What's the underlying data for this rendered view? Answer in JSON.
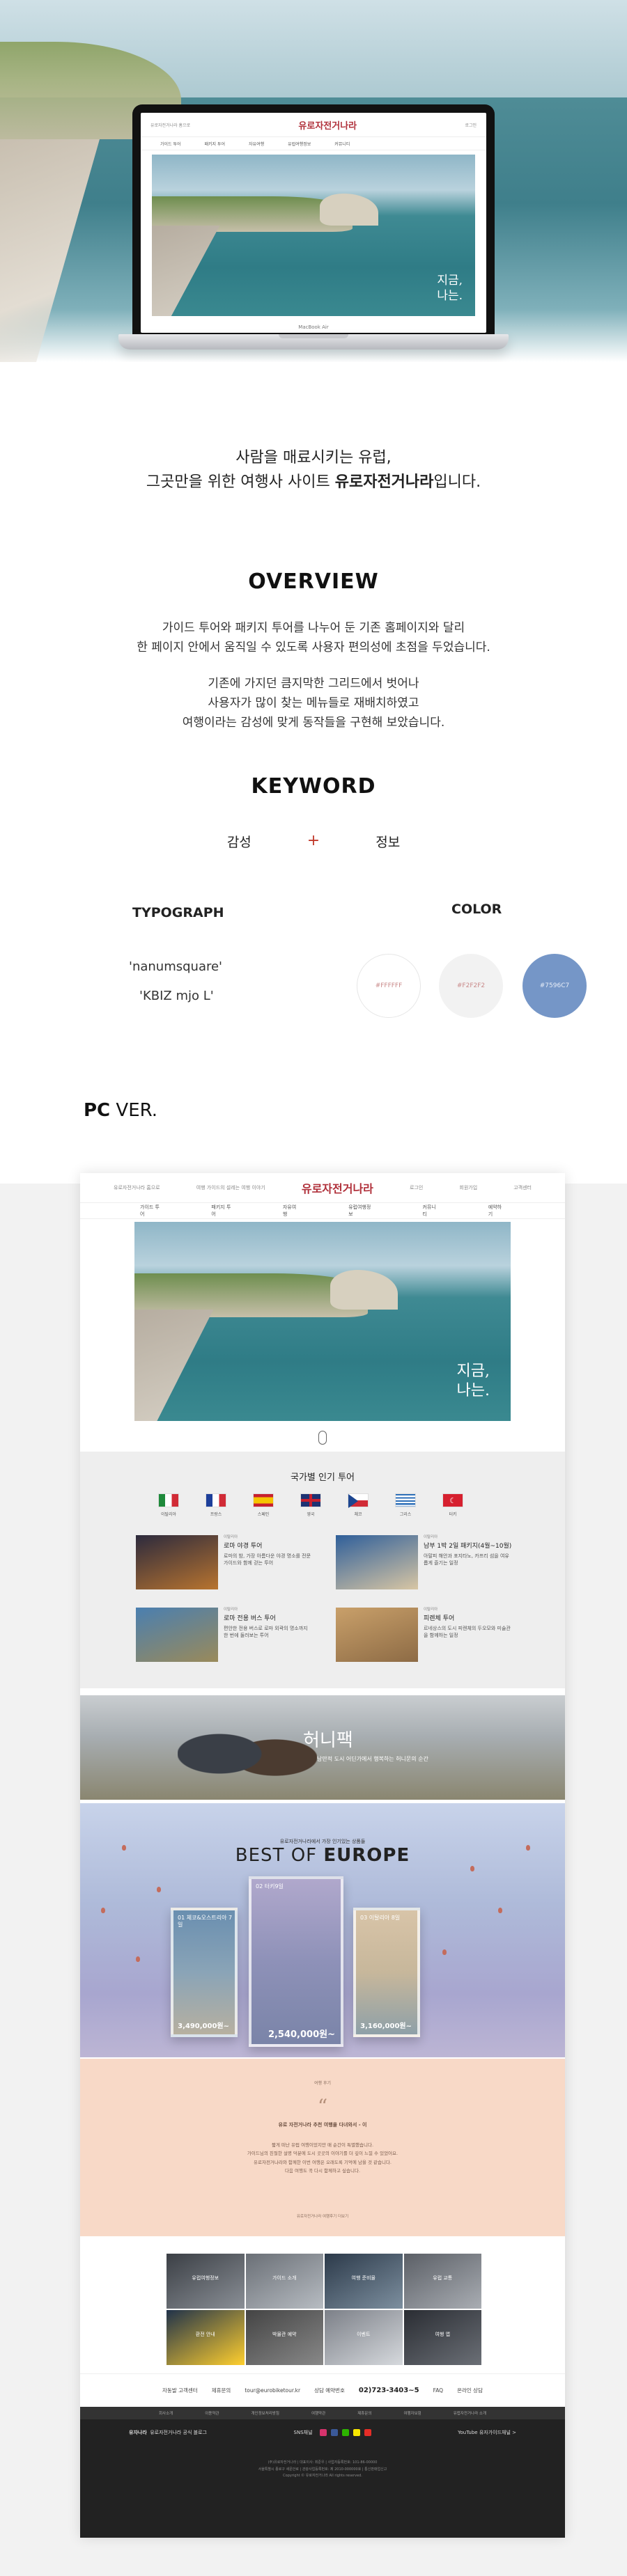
{
  "hero": {
    "laptop_label": "MacBook Air",
    "site_slogan": [
      "지금,",
      "나는."
    ]
  },
  "site": {
    "logo": "유로자전거나라",
    "top_left": [
      "유로자전거나라 홈으로",
      "여행 가이드의 설레는 여행 이야기"
    ],
    "top_right": [
      "로그인",
      "회원가입",
      "고객센터"
    ],
    "nav": [
      "가이드 투어",
      "패키지 투어",
      "자유여행",
      "유럽여행정보",
      "커뮤니티",
      "예약하기"
    ]
  },
  "intro": {
    "line1": "사람을 매료시키는 유럽,",
    "line2_prefix": "그곳만을 위한 여행사 사이트 ",
    "line2_brand": "유로자전거나라",
    "line2_suffix": "입니다."
  },
  "overview": {
    "title": "OVERVIEW",
    "p1": [
      "가이드 투어와 패키지 투어를 나누어 둔 기존 홈페이지와 달리",
      "한 페이지 안에서 움직일 수 있도록 사용자 편의성에 초점을 두었습니다."
    ],
    "p2": [
      "기존에 가지던 큼지막한 그리드에서 벗어나",
      "사용자가 많이 찾는 메뉴들로 재배치하였고",
      "여행이라는 감성에 맞게 동작들을 구현해 보았습니다."
    ]
  },
  "keyword": {
    "title": "KEYWORD",
    "left": "감성",
    "plus": "+",
    "right": "정보"
  },
  "typography": {
    "title": "TYPOGRAPH",
    "fonts": [
      "'nanumsquare'",
      "'KBIZ mjo L'"
    ]
  },
  "color": {
    "title": "COLOR",
    "swatches": [
      {
        "label": "#FFFFFF",
        "hex": "#FFFFFF"
      },
      {
        "label": "#F2F2F2",
        "hex": "#F2F2F2"
      },
      {
        "label": "#7596C7",
        "hex": "#7596C7"
      }
    ]
  },
  "pc_ver": {
    "bold": "PC",
    "rest": " VER."
  },
  "popular": {
    "title": "국가별 인기 투어",
    "flags": [
      {
        "name": "이탈리아",
        "colors": [
          "#1f8a3b",
          "#ffffff",
          "#d12b36"
        ],
        "dir": "v"
      },
      {
        "name": "프랑스",
        "colors": [
          "#1d3f9a",
          "#ffffff",
          "#d12b36"
        ],
        "dir": "v"
      },
      {
        "name": "스페인",
        "colors": [
          "#c8202f",
          "#f6c400",
          "#c8202f"
        ],
        "dir": "h"
      },
      {
        "name": "영국",
        "colors": [
          "#1d3273",
          "#ffffff",
          "#c8202f"
        ],
        "dir": "uk"
      },
      {
        "name": "체코",
        "colors": [
          "#ffffff",
          "#d12b36",
          "#1d4690"
        ],
        "dir": "cz"
      },
      {
        "name": "그리스",
        "colors": [
          "#2d6fb8",
          "#ffffff",
          "#2d6fb8"
        ],
        "dir": "gr"
      },
      {
        "name": "터키",
        "colors": [
          "#d6202f",
          "#ffffff",
          "#d6202f"
        ],
        "dir": "tr"
      }
    ],
    "tours": [
      {
        "tag": "이탈리아",
        "title": "로마 야경 투어",
        "desc": "로마의 밤, 가장 아름다운 야경 명소를 전문 가이드와 함께 걷는 투어",
        "thumb": [
          "#2c2a3d",
          "#b8742f"
        ]
      },
      {
        "tag": "이탈리아",
        "title": "남부 1박 2일 패키지(4월~10월)",
        "desc": "아말피 해안과 포지타노, 카프리 섬을 여유롭게 즐기는 일정",
        "thumb": [
          "#2f5f9a",
          "#d8c6a4"
        ]
      },
      {
        "tag": "이탈리아",
        "title": "로마 전용 버스 투어",
        "desc": "편안한 전용 버스로 로마 외곽의 명소까지 한 번에 둘러보는 투어",
        "thumb": [
          "#4a7fb0",
          "#9a8a5a"
        ]
      },
      {
        "tag": "이탈리아",
        "title": "피렌체 투어",
        "desc": "르네상스의 도시 피렌체의 두오모와 미술관을 함께하는 일정",
        "thumb": [
          "#c9a06a",
          "#8d6b45"
        ]
      }
    ]
  },
  "honeymoon": {
    "title": "허니팩",
    "sub": "낭만적 도시 어딘가에서 행복하는 허니문의 순간"
  },
  "best": {
    "sub": "유로자전거나라에서 가장 인기있는 상품들",
    "title_plain": "BEST OF ",
    "title_bold": "EUROPE",
    "cards": [
      {
        "label": "01 체코&오스트리아 7일",
        "price": "3,490,000원~"
      },
      {
        "label": "02 터키9일",
        "price": "2,540,000원~"
      },
      {
        "label": "03 이탈리아 8일",
        "price": "3,160,000원~"
      }
    ]
  },
  "review": {
    "tag": "여행 후기",
    "quote": "“",
    "head": "유로 자전거나라 추천 여행을 다녀와서 - 이",
    "body": [
      "짧게 떠난 유럽 여행이었지만 매 순간이 특별했습니다.",
      "가이드님의 친절한 설명 덕분에 도시 곳곳의 이야기를 더 깊이 느낄 수 있었어요.",
      "유로자전거나라와 함께한 이번 여행은 오래도록 기억에 남을 것 같습니다.",
      "다음 여행도 꼭 다시 함께하고 싶습니다."
    ],
    "foot": "유로자전거나라 여행후기 더보기"
  },
  "gallery": [
    "유럽여행정보",
    "가이드 소개",
    "여행 준비물",
    "유럽 교통",
    "환전 안내",
    "박물관 예약",
    "이벤트",
    "여행 앱"
  ],
  "contact": {
    "items": [
      "자동발 고객센터",
      "제휴문의",
      "tour@eurobiketour.kr",
      "상담 예약번호"
    ],
    "phone": "02)723-3403~5",
    "extra": [
      "FAQ",
      "온라인 상담"
    ]
  },
  "footer": {
    "menu": [
      "회사소개",
      "이용약관",
      "개인정보처리방침",
      "여행약관",
      "제휴문의",
      "여행자보험",
      "유럽자전거나라 소개"
    ],
    "left": "유자나라",
    "left_sub": "유로자전거나라 공식 블로그",
    "sns_label": "SNS채널",
    "right": "YouTube 유자가이드채널 >",
    "fine": [
      "(주)유로자전거나라 | 대표이사: 최준우 | 사업자등록번호: 101-86-00000",
      "서울특별시 종로구 새문안로 | 관광사업등록번호: 제 2010-000000호 | 통신판매업신고",
      "Copyright © 유로자전거나라 All rights reserved."
    ]
  }
}
